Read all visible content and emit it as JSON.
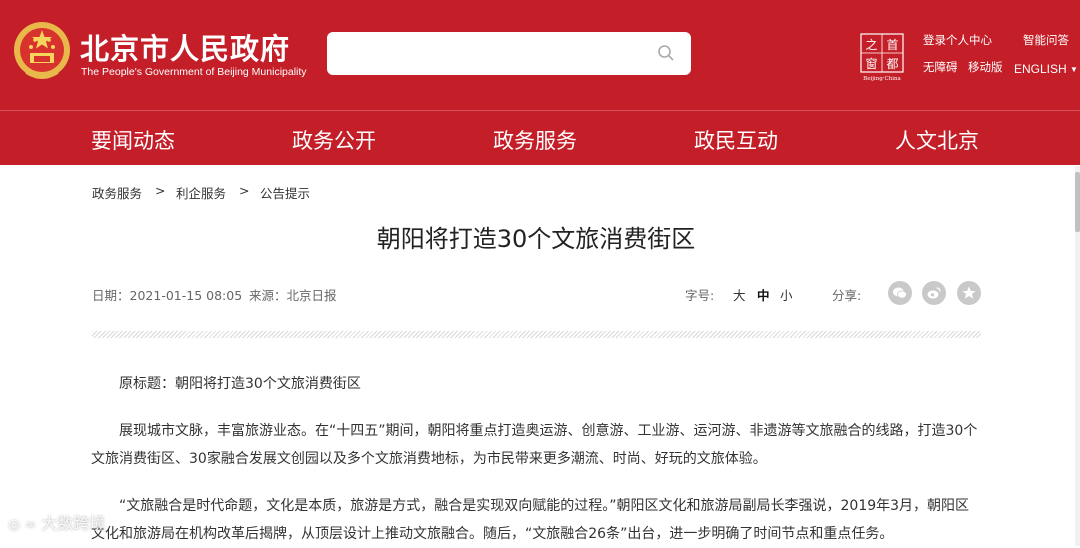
{
  "header": {
    "site_title": "北京市人民政府",
    "site_subtitle": "The People's Government of Beijing Municipality",
    "search_placeholder": "",
    "logo_chars": [
      "之",
      "首",
      "窗",
      "都"
    ],
    "logo_caption": "Beijing·China",
    "links": {
      "login": "登录个人中心",
      "smart_qa": "智能问答",
      "accessible": "无障碍",
      "mobile": "移动版",
      "english": "ENGLISH"
    }
  },
  "nav": [
    "要闻动态",
    "政务公开",
    "政务服务",
    "政民互动",
    "人文北京"
  ],
  "breadcrumb": [
    "政务服务",
    "利企服务",
    "公告提示"
  ],
  "breadcrumb_sep": ">",
  "article": {
    "title": "朝阳将打造30个文旅消费街区",
    "date_label": "日期：",
    "date": "2021-01-15 08:05",
    "source_label": "来源：",
    "source": "北京日报",
    "font_size_label": "字号:",
    "font_sizes": [
      "大",
      "中",
      "小"
    ],
    "share_label": "分享:",
    "share_icons": [
      "wechat-icon",
      "weibo-icon",
      "favorite-icon"
    ],
    "paragraphs": [
      "原标题：朝阳将打造30个文旅消费街区",
      "展现城市文脉，丰富旅游业态。在“十四五”期间，朝阳将重点打造奥运游、创意游、工业游、运河游、非遗游等文旅融合的线路，打造30个文旅消费街区、30家融合发展文创园以及多个文旅消费地标，为市民带来更多潮流、时尚、好玩的文旅体验。",
      "“文旅融合是时代命题，文化是本质，旅游是方式，融合是实现双向赋能的过程。”朝阳区文化和旅游局副局长李强说，2019年3月，朝阳区文化和旅游局在机构改革后揭牌，从顶层设计上推动文旅融合。随后，“文旅融合26条”出台，进一步明确了时间节点和重点任务。"
    ]
  },
  "watermark": "大数跨境",
  "colors": {
    "brand_red": "#c41e28",
    "text": "#333333"
  }
}
